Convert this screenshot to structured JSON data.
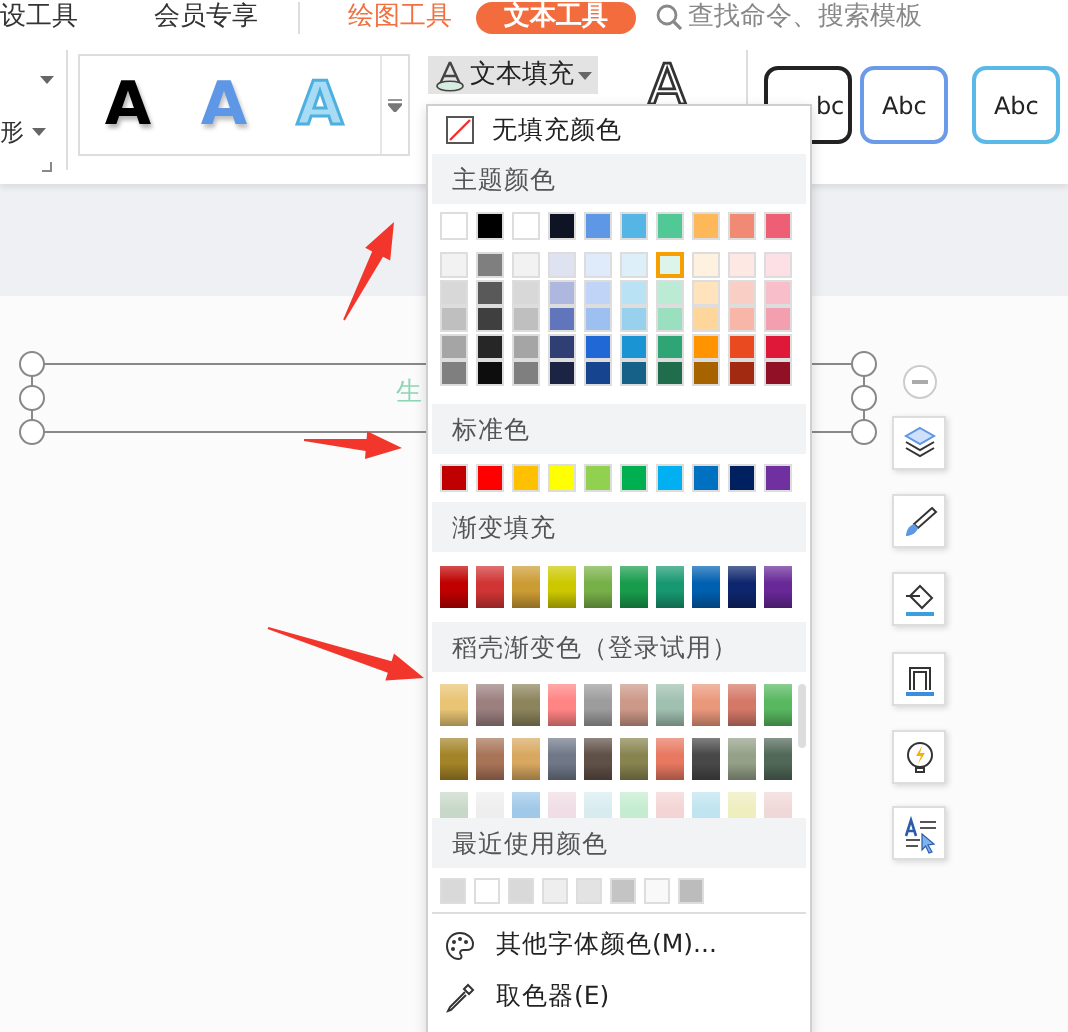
{
  "tabs": [
    {
      "label": "设工具",
      "selected": false,
      "kind": "main"
    },
    {
      "label": "会员专享",
      "selected": false,
      "kind": "main"
    },
    {
      "label": "绘图工具",
      "selected": false,
      "kind": "context"
    },
    {
      "label": "文本工具",
      "selected": true,
      "kind": "context"
    }
  ],
  "search": {
    "placeholder": "查找命令、搜索模板"
  },
  "ribbon": {
    "left_label": "形",
    "effect_previews": [
      {
        "text": "A",
        "kind": "solid"
      },
      {
        "text": "A",
        "kind": "shadow"
      },
      {
        "text": "A",
        "kind": "outline"
      }
    ],
    "text_fill_button": {
      "label": "文本填充",
      "expanded": true
    },
    "outline_button": {
      "label": "A"
    },
    "shape_styles": [
      {
        "label": "bc",
        "color": "#222222"
      },
      {
        "label": "Abc",
        "color": "#6b9be8"
      },
      {
        "label": "Abc",
        "color": "#5bb9e8"
      }
    ]
  },
  "canvas": {
    "text": "生"
  },
  "fill_menu": {
    "no_fill": {
      "label": "无填充颜色"
    },
    "theme": {
      "title": "主题颜色",
      "swatches": [
        {
          "color": "#ffffff",
          "selected": false
        },
        {
          "color": "#000000",
          "selected": false
        },
        {
          "color": "#ffffff",
          "selected": false
        },
        {
          "color": "#0e1424",
          "selected": false
        },
        {
          "color": "#5e97e6",
          "selected": false
        },
        {
          "color": "#55b5e4",
          "selected": false
        },
        {
          "color": "#51c997",
          "selected": false
        },
        {
          "color": "#fdb85a",
          "selected": false
        },
        {
          "color": "#f08a74",
          "selected": false
        },
        {
          "color": "#ee5f75",
          "selected": false
        }
      ],
      "shades": [
        [
          {
            "color": "#f2f2f2",
            "selected": false
          },
          {
            "color": "#7f7f7f",
            "selected": false
          },
          {
            "color": "#f2f2f2",
            "selected": false
          },
          {
            "color": "#dfe2f0",
            "selected": false
          },
          {
            "color": "#dfeafb",
            "selected": false
          },
          {
            "color": "#ddf0fa",
            "selected": false
          },
          {
            "color": "#dcf4ea",
            "selected": true
          },
          {
            "color": "#fff1df",
            "selected": false
          },
          {
            "color": "#fde8e3",
            "selected": false
          },
          {
            "color": "#fde0e6",
            "selected": false
          }
        ],
        [
          {
            "color": "#d8d8d8",
            "selected": false
          },
          {
            "color": "#595959",
            "selected": false
          },
          {
            "color": "#d8d8d8",
            "selected": false
          },
          {
            "color": "#aeb8de",
            "selected": false
          },
          {
            "color": "#bfd4f6",
            "selected": false
          },
          {
            "color": "#b9e2f5",
            "selected": false
          },
          {
            "color": "#bbebd5",
            "selected": false
          },
          {
            "color": "#ffe3bd",
            "selected": false
          },
          {
            "color": "#f9cfc5",
            "selected": false
          },
          {
            "color": "#f8bfcb",
            "selected": false
          }
        ],
        [
          {
            "color": "#bfbfbf",
            "selected": false
          },
          {
            "color": "#3f3f3f",
            "selected": false
          },
          {
            "color": "#bfbfbf",
            "selected": false
          },
          {
            "color": "#6075bc",
            "selected": false
          },
          {
            "color": "#9ec0f0",
            "selected": false
          },
          {
            "color": "#97d1ee",
            "selected": false
          },
          {
            "color": "#9ae0c0",
            "selected": false
          },
          {
            "color": "#fed59b",
            "selected": false
          },
          {
            "color": "#f7b6a8",
            "selected": false
          },
          {
            "color": "#f39faf",
            "selected": false
          }
        ],
        [
          {
            "color": "#a5a5a5",
            "selected": false
          },
          {
            "color": "#262626",
            "selected": false
          },
          {
            "color": "#a5a5a5",
            "selected": false
          },
          {
            "color": "#2f3f73",
            "selected": false
          },
          {
            "color": "#1f68d6",
            "selected": false
          },
          {
            "color": "#1b94d4",
            "selected": false
          },
          {
            "color": "#2fa575",
            "selected": false
          },
          {
            "color": "#ff9400",
            "selected": false
          },
          {
            "color": "#e94a1f",
            "selected": false
          },
          {
            "color": "#df1738",
            "selected": false
          }
        ],
        [
          {
            "color": "#7f7f7f",
            "selected": false
          },
          {
            "color": "#0d0d0d",
            "selected": false
          },
          {
            "color": "#7f7f7f",
            "selected": false
          },
          {
            "color": "#1c2444",
            "selected": false
          },
          {
            "color": "#16448f",
            "selected": false
          },
          {
            "color": "#166187",
            "selected": false
          },
          {
            "color": "#206d4d",
            "selected": false
          },
          {
            "color": "#a76300",
            "selected": false
          },
          {
            "color": "#a22a11",
            "selected": false
          },
          {
            "color": "#921025",
            "selected": false
          }
        ]
      ]
    },
    "standard": {
      "title": "标准色",
      "swatches": [
        {
          "color": "#c00000",
          "selected": false
        },
        {
          "color": "#ff0000",
          "selected": false
        },
        {
          "color": "#ffc000",
          "selected": false
        },
        {
          "color": "#ffff00",
          "selected": false
        },
        {
          "color": "#92d050",
          "selected": false
        },
        {
          "color": "#00b050",
          "selected": false
        },
        {
          "color": "#00b0f0",
          "selected": false
        },
        {
          "color": "#0070c0",
          "selected": false
        },
        {
          "color": "#002060",
          "selected": false
        },
        {
          "color": "#7030a0",
          "selected": false
        }
      ]
    },
    "gradient": {
      "title": "渐变填充",
      "swatches": [
        {
          "color": "#c00000",
          "selected": false
        },
        {
          "color": "#d03434",
          "selected": false
        },
        {
          "color": "#cc9c34",
          "selected": false
        },
        {
          "color": "#ccc800",
          "selected": false
        },
        {
          "color": "#78b048",
          "selected": false
        },
        {
          "color": "#189c4c",
          "selected": false
        },
        {
          "color": "#189870",
          "selected": false
        },
        {
          "color": "#0060b0",
          "selected": false
        },
        {
          "color": "#0e266d",
          "selected": false
        },
        {
          "color": "#682898",
          "selected": false
        }
      ]
    },
    "docer": {
      "title": "稻壳渐变色（登录试用）",
      "rows": [
        [
          {
            "color": "#e8c474",
            "selected": false
          },
          {
            "color": "#9c8080",
            "selected": false
          },
          {
            "color": "#8c845c",
            "selected": false
          },
          {
            "color": "#ff8484",
            "selected": false
          },
          {
            "color": "#9c9c9c",
            "selected": false
          },
          {
            "color": "#cc9888",
            "selected": false
          },
          {
            "color": "#a0c0b0",
            "selected": false
          },
          {
            "color": "#ea987c",
            "selected": false
          },
          {
            "color": "#d47868",
            "selected": false
          },
          {
            "color": "#58b860",
            "selected": false
          }
        ],
        [
          {
            "color": "#a48428",
            "selected": false
          },
          {
            "color": "#a87458",
            "selected": false
          },
          {
            "color": "#d8a860",
            "selected": false
          },
          {
            "color": "#707888",
            "selected": false
          },
          {
            "color": "#605048",
            "selected": false
          },
          {
            "color": "#888450",
            "selected": false
          },
          {
            "color": "#e87860",
            "selected": false
          },
          {
            "color": "#484848",
            "selected": false
          },
          {
            "color": "#94a088",
            "selected": false
          },
          {
            "color": "#506858",
            "selected": false
          }
        ],
        [
          {
            "color": "#c8d8c8",
            "selected": false
          },
          {
            "color": "#eeeeee",
            "selected": false
          },
          {
            "color": "#a0c8e8",
            "selected": false
          },
          {
            "color": "#f0dde5",
            "selected": false
          },
          {
            "color": "#d8ecf0",
            "selected": false
          },
          {
            "color": "#c4ecd0",
            "selected": false
          },
          {
            "color": "#f4d4d4",
            "selected": false
          },
          {
            "color": "#c0e4f0",
            "selected": false
          },
          {
            "color": "#eeeebf",
            "selected": false
          },
          {
            "color": "#f0d8d8",
            "selected": false
          }
        ]
      ]
    },
    "recent": {
      "title": "最近使用颜色",
      "swatches": [
        {
          "color": "#d9d9d9",
          "selected": false
        },
        {
          "color": "#ffffff",
          "selected": false
        },
        {
          "color": "#d9d9d9",
          "selected": false
        },
        {
          "color": "#eeeeee",
          "selected": false
        },
        {
          "color": "#e3e3e3",
          "selected": false
        },
        {
          "color": "#c4c4c4",
          "selected": false
        },
        {
          "color": "#f9f9f9",
          "selected": false
        },
        {
          "color": "#bcbcbc",
          "selected": false
        }
      ]
    },
    "actions": [
      {
        "label": "其他字体颜色(M)...",
        "kind": "palette"
      },
      {
        "label": "取色器(E)",
        "kind": "eyedropper"
      }
    ]
  }
}
